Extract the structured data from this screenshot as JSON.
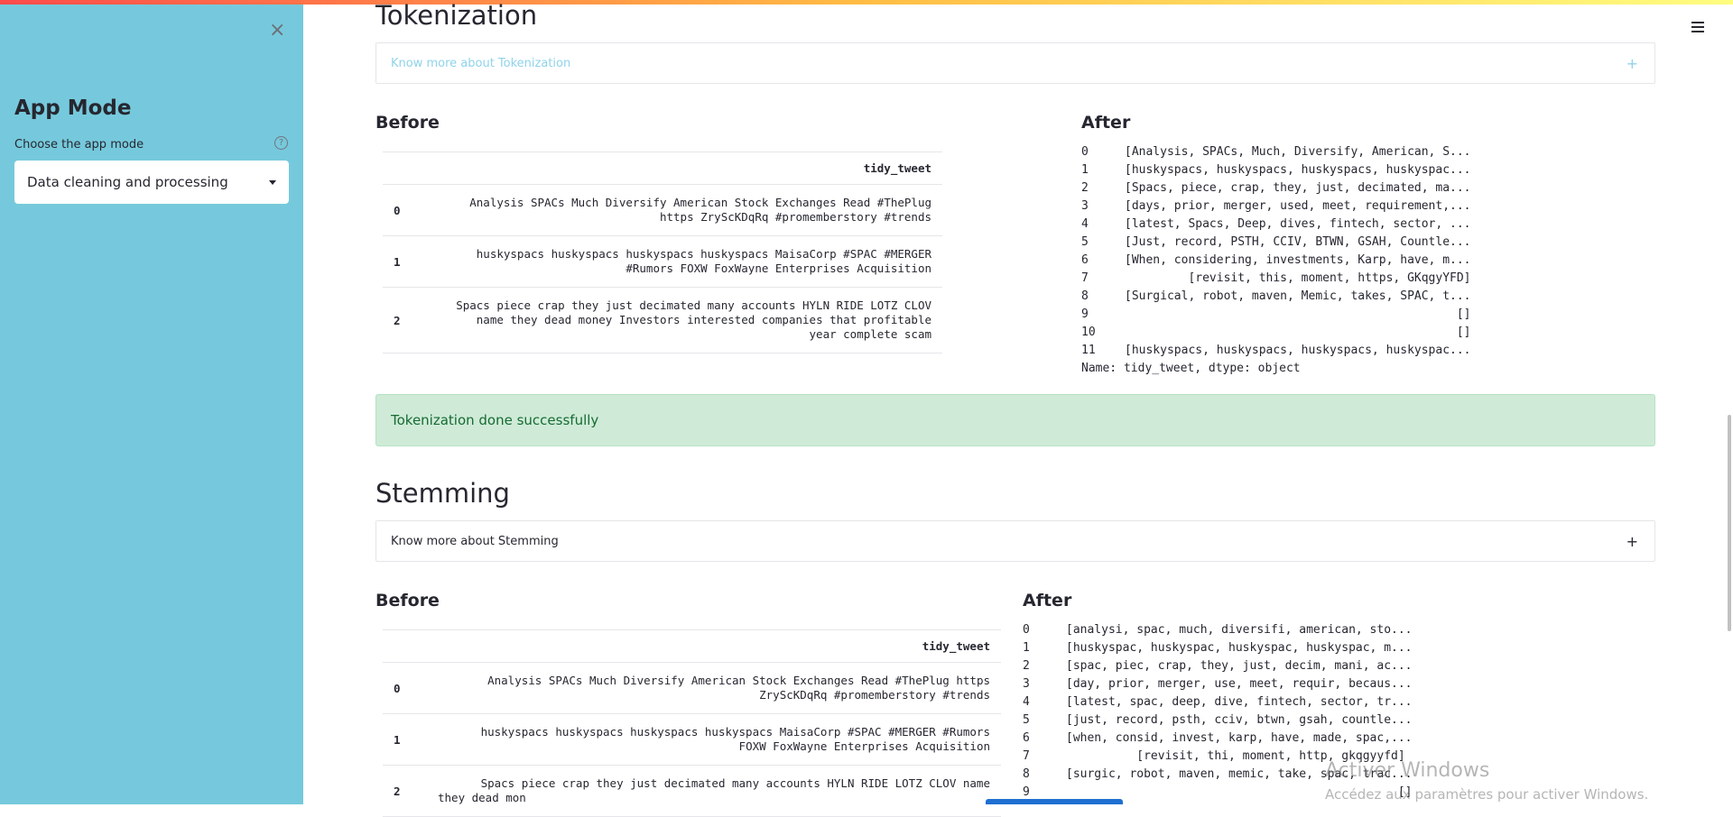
{
  "sidebar": {
    "title": "App Mode",
    "select_label": "Choose the app mode",
    "select_value": "Data cleaning and processing",
    "help_icon": "?",
    "close_icon": "×"
  },
  "sections": [
    {
      "title": "Tokenization",
      "expander_label": "Know more about Tokenization",
      "expander_icon": "+",
      "before_title": "Before",
      "after_title": "After",
      "table_column": "tidy_tweet",
      "table_rows": [
        {
          "index": "0",
          "lines": [
            "Analysis SPACs Much Diversify American Stock Exchanges Read #ThePlug",
            "https ZrySсKDqRq #promemberstory #trends"
          ]
        },
        {
          "index": "1",
          "lines": [
            "huskyspacs huskyspacs huskyspacs huskyspacs MaisaCorp #SPAC #MERGER",
            "#Rumors FOXW FoxWayne Enterprises Acquisition"
          ]
        },
        {
          "index": "2",
          "lines": [
            "Spacs piece crap they just decimated many accounts HYLN RIDE LOTZ CLOV",
            "name they dead money Investors interested companies that profitable",
            "year complete scam"
          ]
        }
      ],
      "series": [
        {
          "index": "0",
          "value": "[Analysis, SPACs, Much, Diversify, American, S..."
        },
        {
          "index": "1",
          "value": "[huskyspacs, huskyspacs, huskyspacs, huskyspac..."
        },
        {
          "index": "2",
          "value": "[Spacs, piece, crap, they, just, decimated, ma..."
        },
        {
          "index": "3",
          "value": "[days, prior, merger, used, meet, requirement,..."
        },
        {
          "index": "4",
          "value": "[latest, Spacs, Deep, dives, fintech, sector, ..."
        },
        {
          "index": "5",
          "value": "[Just, record, PSTH, CCIV, BTWN, GSAH, Countle..."
        },
        {
          "index": "6",
          "value": "[When, considering, investments, Karp, have, m..."
        },
        {
          "index": "7",
          "value": "         [revisit, this, moment, https, GKqgyYFD]"
        },
        {
          "index": "8",
          "value": "[Surgical, robot, maven, Memic, takes, SPAC, t..."
        },
        {
          "index": "9",
          "value": "                                               []"
        },
        {
          "index": "10",
          "value": "                                               []"
        },
        {
          "index": "11",
          "value": "[huskyspacs, huskyspacs, huskyspacs, huskyspac..."
        }
      ],
      "series_footer": "Name: tidy_tweet, dtype: object",
      "success_message": "Tokenization done successfully"
    },
    {
      "title": "Stemming",
      "expander_label": "Know more about Stemming",
      "expander_icon": "+",
      "before_title": "Before",
      "after_title": "After",
      "table_column": "tidy_tweet",
      "table_rows": [
        {
          "index": "0",
          "lines": [
            "Analysis SPACs Much Diversify American Stock Exchanges Read #ThePlug https",
            "ZrySсKDqRq #promemberstory #trends"
          ]
        },
        {
          "index": "1",
          "lines": [
            "huskyspacs huskyspacs huskyspacs huskyspacs MaisaCorp #SPAC #MERGER #Rumors",
            "FOXW FoxWayne Enterprises Acquisition"
          ]
        },
        {
          "index": "2",
          "lines": [
            "Spacs piece crap they just decimated many accounts HYLN RIDE LOTZ CLOV name",
            "they dead mon"
          ]
        }
      ],
      "series": [
        {
          "index": "0",
          "value": "[analysi, spac, much, diversifi, american, sto..."
        },
        {
          "index": "1",
          "value": "[huskyspac, huskyspac, huskyspac, huskyspac, m..."
        },
        {
          "index": "2",
          "value": "[spac, piec, crap, they, just, decim, mani, ac..."
        },
        {
          "index": "3",
          "value": "[day, prior, merger, use, meet, requir, becaus..."
        },
        {
          "index": "4",
          "value": "[latest, spac, deep, dive, fintech, sector, tr..."
        },
        {
          "index": "5",
          "value": "[just, record, psth, cciv, btwn, gsah, countle..."
        },
        {
          "index": "6",
          "value": "[when, consid, invest, karp, have, made, spac,..."
        },
        {
          "index": "7",
          "value": "          [revisit, thi, moment, http, gkqgyyfd]"
        },
        {
          "index": "8",
          "value": "[surgic, robot, maven, memic, take, spac, trac..."
        },
        {
          "index": "9",
          "value": "                                               []"
        }
      ]
    }
  ],
  "watermark": {
    "line1": "Activer Windows",
    "line2": "Accédez aux paramètres pour activer Windows."
  },
  "colors": {
    "sidebar": "#76c9dc",
    "success_bg": "#cfebd8",
    "success_text": "#176b32",
    "link_muted": "#8fd3ea"
  }
}
